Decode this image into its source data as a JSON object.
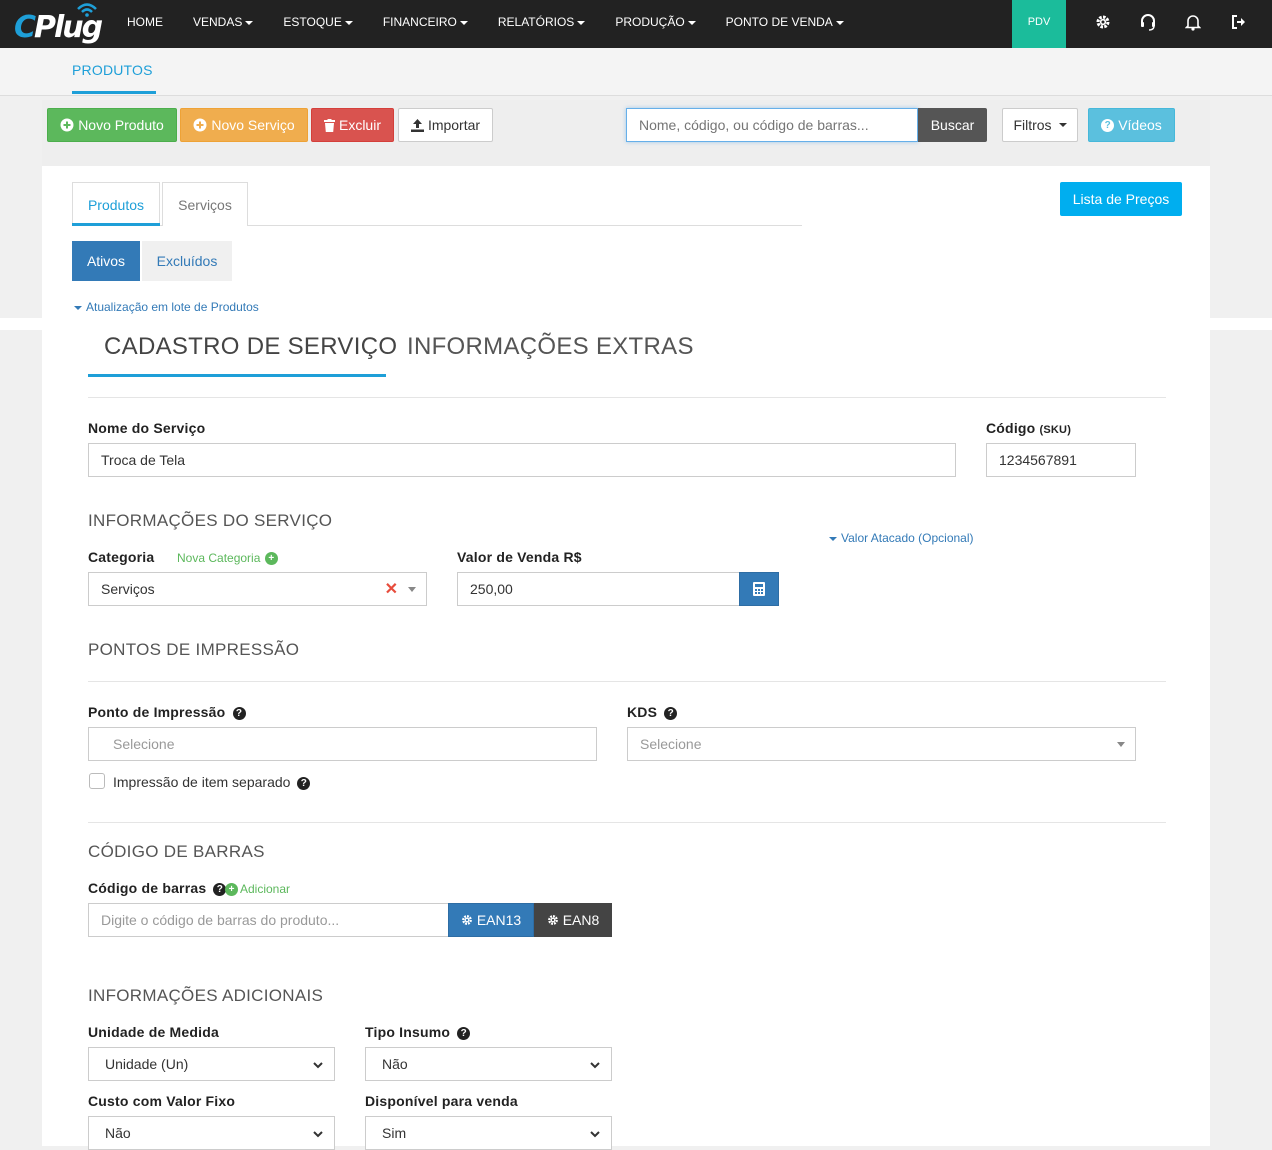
{
  "app": {
    "logo_text_c": "C",
    "logo_text_rest": "Plug",
    "brand_color": "#1e9fd8"
  },
  "topnav": {
    "items": [
      {
        "label": "HOME",
        "dropdown": false
      },
      {
        "label": "VENDAS",
        "dropdown": true
      },
      {
        "label": "ESTOQUE",
        "dropdown": true
      },
      {
        "label": "FINANCEIRO",
        "dropdown": true
      },
      {
        "label": "RELATÓRIOS",
        "dropdown": true
      },
      {
        "label": "PRODUÇÃO",
        "dropdown": true
      },
      {
        "label": "PONTO DE VENDA",
        "dropdown": true
      }
    ],
    "pdv_label": "PDV",
    "icons": [
      "gear-icon",
      "headset-icon",
      "bell-icon",
      "logout-icon"
    ]
  },
  "subnav": {
    "active_tab": "PRODUTOS"
  },
  "toolbar": {
    "new_product": "Novo Produto",
    "new_service": "Novo Serviço",
    "delete": "Excluir",
    "import": "Importar",
    "search_placeholder": "Nome, código, ou código de barras...",
    "search_button": "Buscar",
    "filters": "Filtros",
    "videos": "Vídeos"
  },
  "tabs": {
    "products": "Produtos",
    "services": "Serviços",
    "price_list": "Lista de Preços",
    "active": "Ativos",
    "deleted": "Excluídos",
    "batch_update": "Atualização em lote de Produtos"
  },
  "form": {
    "tab_service": "CADASTRO DE SERVIÇO",
    "tab_extra": "INFORMAÇÕES EXTRAS",
    "service_name_label": "Nome do Serviço",
    "service_name_value": "Troca de Tela",
    "code_label": "Código",
    "code_sku": "(SKU)",
    "code_value": "1234567891",
    "section_info": "INFORMAÇÕES DO SERVIÇO",
    "wholesale_link": "Valor Atacado (Opcional)",
    "category_label": "Categoria",
    "new_category": "Nova Categoria",
    "category_value": "Serviços",
    "sale_value_label": "Valor de Venda R$",
    "sale_value": "250,00",
    "section_print": "PONTOS DE IMPRESSÃO",
    "print_point_label": "Ponto de Impressão",
    "print_point_placeholder": "Selecione",
    "kds_label": "KDS",
    "kds_placeholder": "Selecione",
    "separate_print_label": "Impressão de item separado",
    "section_barcode": "CÓDIGO DE BARRAS",
    "barcode_label": "Código de barras",
    "barcode_add": "Adicionar",
    "barcode_placeholder": "Digite o código de barras do produto...",
    "ean13": "EAN13",
    "ean8": "EAN8",
    "section_additional": "INFORMAÇÕES ADICIONAIS",
    "unit_label": "Unidade de Medida",
    "unit_value": "Unidade (Un)",
    "input_type_label": "Tipo Insumo",
    "input_type_value": "Não",
    "fixed_cost_label": "Custo com Valor Fixo",
    "fixed_cost_value": "Não",
    "available_label": "Disponível para venda",
    "available_value": "Sim"
  }
}
